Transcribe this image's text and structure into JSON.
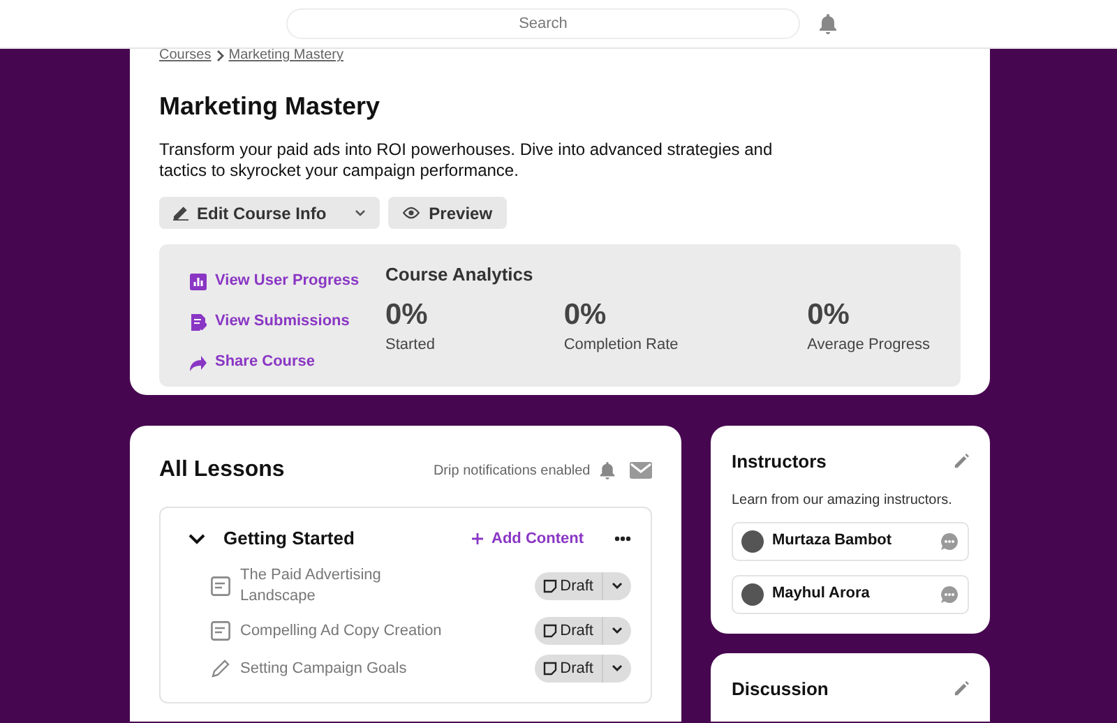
{
  "header": {
    "search_placeholder": "Search"
  },
  "breadcrumb": [
    "Courses",
    "Marketing Mastery"
  ],
  "course": {
    "title": "Marketing Mastery",
    "description": "Transform your paid ads into ROI powerhouses. Dive into advanced strategies and tactics to skyrocket your campaign performance.",
    "buttons": [
      "Edit Course Info",
      "Preview"
    ]
  },
  "quick_links": [
    {
      "kind": "chart",
      "label": "View User Progress"
    },
    {
      "kind": "submissions",
      "label": "View Submissions"
    },
    {
      "kind": "share",
      "label": "Share Course"
    }
  ],
  "analytics": {
    "title": "Course Analytics",
    "stats": [
      {
        "value": "0%",
        "label": "Started"
      },
      {
        "value": "0%",
        "label": "Completion Rate"
      },
      {
        "value": "0%",
        "label": "Average Progress"
      }
    ]
  },
  "lessons": {
    "title": "All Lessons",
    "drip_text": "Drip notifications enabled",
    "sections": [
      {
        "title": "Getting Started",
        "expanded": true,
        "add_label": "Add Content",
        "items": [
          {
            "kind": "text",
            "title": "The Paid Advertising Landscape",
            "status": "Draft"
          },
          {
            "kind": "text",
            "title": "Compelling Ad Copy Creation",
            "status": "Draft"
          },
          {
            "kind": "assignment",
            "title": "Setting Campaign Goals",
            "status": "Draft"
          }
        ]
      }
    ]
  },
  "instructors": {
    "title": "Instructors",
    "subtitle": "Learn from our amazing instructors.",
    "people": [
      {
        "name": "Murtaza Bambot"
      },
      {
        "name": "Mayhul Arora"
      }
    ]
  },
  "discussion": {
    "title": "Discussion"
  }
}
